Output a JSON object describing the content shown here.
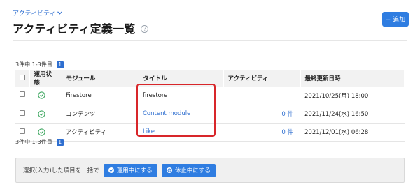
{
  "breadcrumb": {
    "label": "アクティビティ"
  },
  "header": {
    "title": "アクティビティ定義一覧",
    "help_symbol": "?"
  },
  "toolbar": {
    "add_label": "+ 追加"
  },
  "pagination": {
    "summary": "3件中 1-3件目",
    "current_page": "1"
  },
  "table": {
    "columns": [
      "運用状態",
      "モジュール",
      "タイトル",
      "アクティビティ",
      "最終更新日時"
    ],
    "rows": [
      {
        "status": "active",
        "module": "Firestore",
        "title": "firestore",
        "activity_count": "",
        "updated": "2021/10/25(月) 18:00"
      },
      {
        "status": "active",
        "module": "コンテンツ",
        "title": "Content module",
        "activity_count": "0 件",
        "updated": "2021/11/24(水) 16:50"
      },
      {
        "status": "active",
        "module": "アクティビティ",
        "title": "Like",
        "activity_count": "0 件",
        "updated": "2021/12/01(水) 06:28"
      }
    ]
  },
  "bulk_actions": {
    "prompt": "選択(入力)した項目を一括で",
    "activate_label": "運用中にする",
    "suspend_label": "休止中にする"
  },
  "colors": {
    "accent": "#2f7de1",
    "status_ok": "#3aa55d",
    "highlight": "#d8262a"
  },
  "icons": {
    "status": "check-circle-icon",
    "activate": "check-circle-icon",
    "suspend": "block-icon",
    "breadcrumb": "chevron-down-icon",
    "help": "help-icon"
  }
}
